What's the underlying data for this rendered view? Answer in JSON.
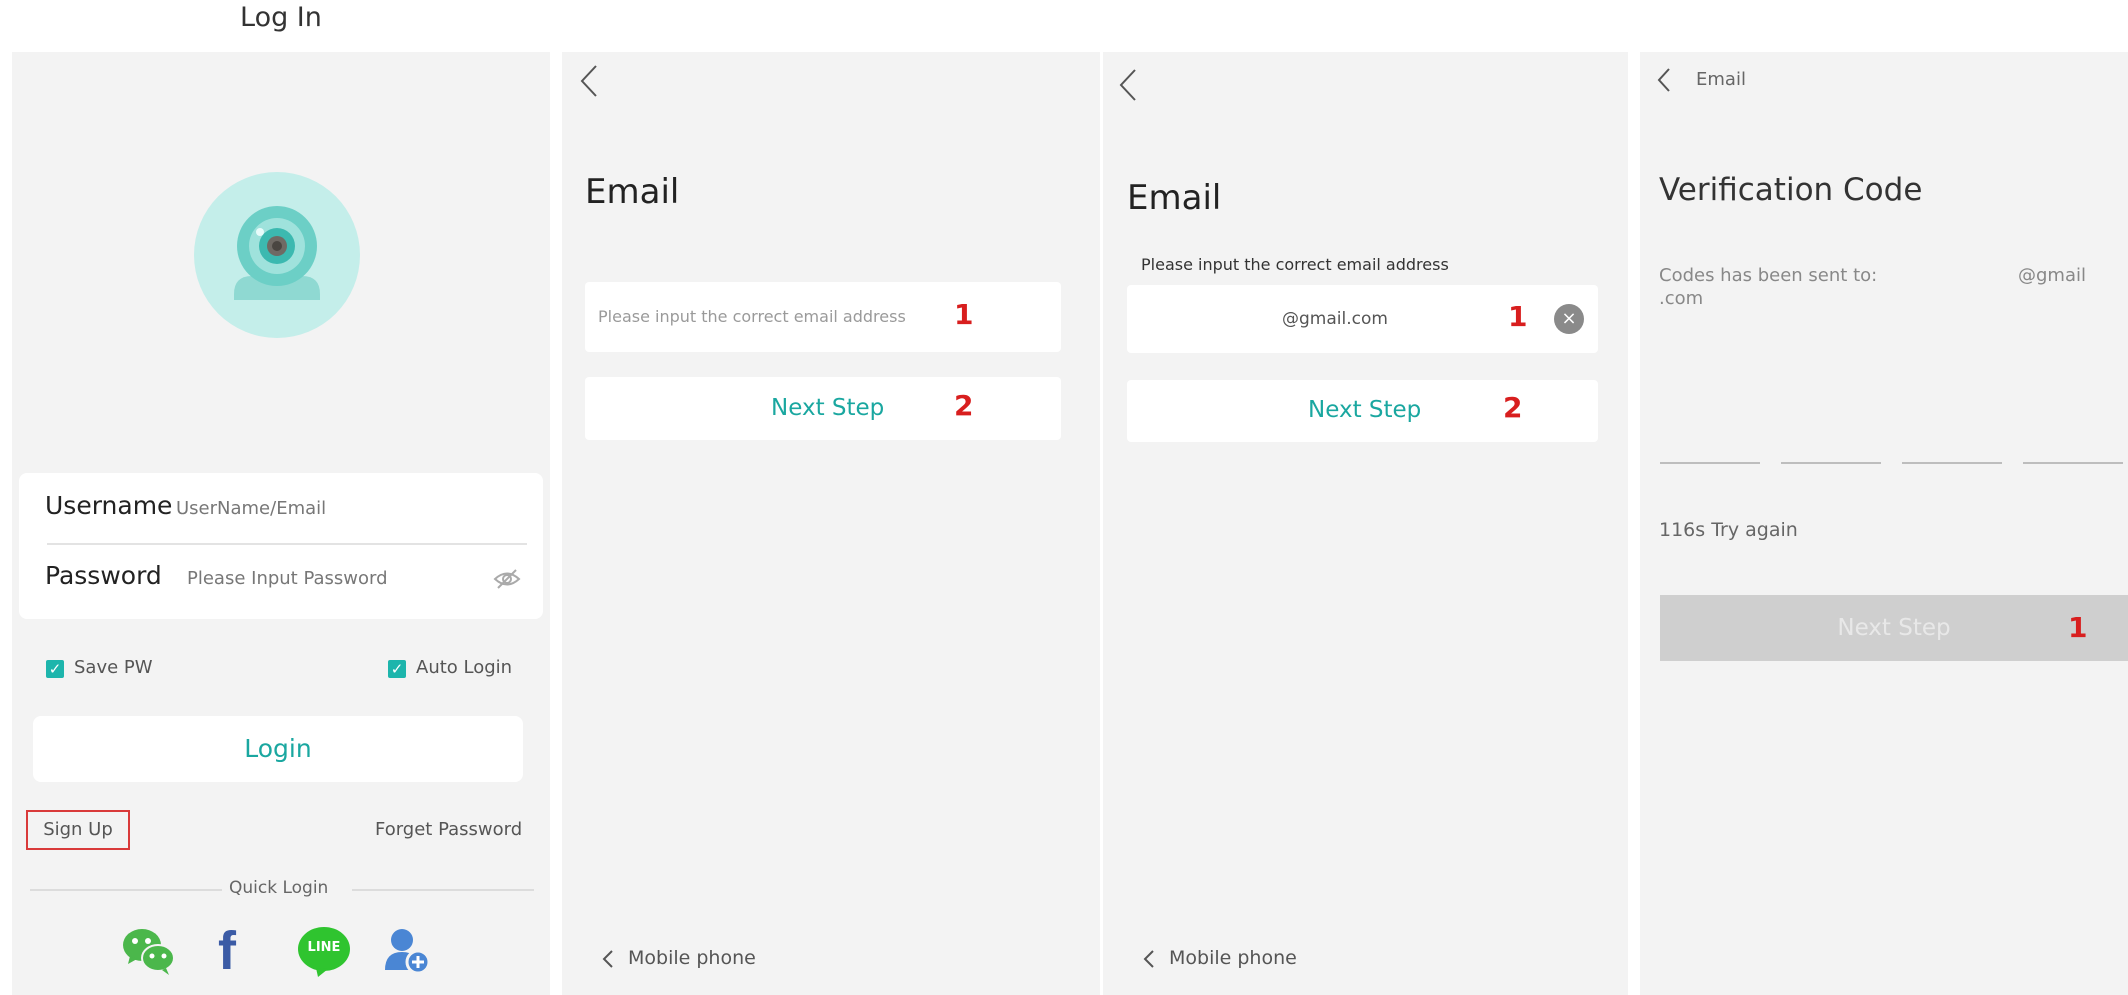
{
  "page_title": "Log In",
  "panel1": {
    "username_label": "Username",
    "username_placeholder": "UserName/Email",
    "password_label": "Password",
    "password_placeholder": "Please Input Password",
    "save_pw_label": "Save PW",
    "auto_login_label": "Auto Login",
    "login_button": "Login",
    "sign_up": "Sign Up",
    "forget_password": "Forget Password",
    "quick_login": "Quick Login",
    "social_icons": [
      "wechat-icon",
      "facebook-icon",
      "line-icon",
      "add-contact-icon"
    ],
    "line_icon_text": "LINE",
    "facebook_icon_text": "f"
  },
  "panel2": {
    "title": "Email",
    "email_placeholder": "Please input the correct email address",
    "marker_1": "1",
    "next_step": "Next Step",
    "marker_2": "2",
    "bottom_link": "Mobile phone"
  },
  "panel3": {
    "title": "Email",
    "hint": "Please input the correct email address",
    "email_value": "@gmail.com",
    "marker_1": "1",
    "next_step": "Next Step",
    "marker_2": "2",
    "bottom_link": "Mobile phone"
  },
  "panel4": {
    "header": "Email",
    "title": "Verification Code",
    "sent_to_label": "Codes has been sent to:",
    "sent_to_value": "@gmail",
    "sent_to_value_2": ".com",
    "timer_text": "116s Try again",
    "next_step": "Next Step",
    "marker_1": "1"
  },
  "colors": {
    "accent": "#1aa7a0",
    "marker_red": "#d81e1e",
    "panel_bg": "#f3f3f3"
  }
}
